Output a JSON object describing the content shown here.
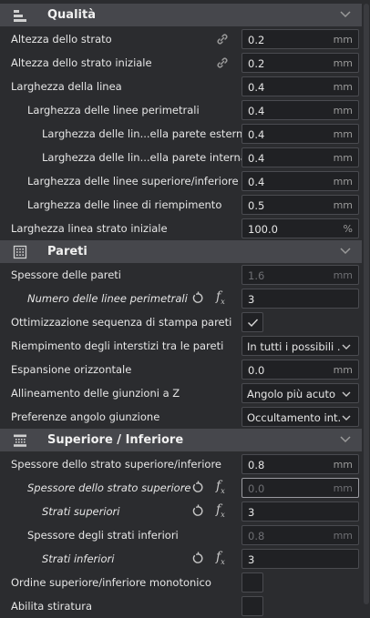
{
  "sections": {
    "quality": {
      "title": "Qualità",
      "icon": "quality-layers-icon"
    },
    "walls": {
      "title": "Pareti",
      "icon": "walls-grid-icon"
    },
    "top_bottom": {
      "title": "Superiore / Inferiore",
      "icon": "top-bottom-icon"
    }
  },
  "quality_rows": [
    {
      "label": "Altezza dello strato",
      "value": "0.2",
      "unit": "mm"
    },
    {
      "label": "Altezza dello strato iniziale",
      "value": "0.2",
      "unit": "mm"
    },
    {
      "label": "Larghezza della linea",
      "value": "0.4",
      "unit": "mm"
    },
    {
      "label": "Larghezza delle linee perimetrali",
      "value": "0.4",
      "unit": "mm"
    },
    {
      "label": "Larghezza delle lin...ella parete esterna",
      "value": "0.4",
      "unit": "mm"
    },
    {
      "label": "Larghezza delle lin...ella parete interna",
      "value": "0.4",
      "unit": "mm"
    },
    {
      "label": "Larghezza delle linee superiore/inferiore",
      "value": "0.4",
      "unit": "mm"
    },
    {
      "label": "Larghezza delle linee di riempimento",
      "value": "0.5",
      "unit": "mm"
    },
    {
      "label": "Larghezza linea strato iniziale",
      "value": "100.0",
      "unit": "%"
    }
  ],
  "walls_rows": [
    {
      "label": "Spessore delle pareti",
      "value": "1.6",
      "unit": "mm"
    },
    {
      "label": "Numero delle linee perimetrali",
      "value": "3",
      "unit": ""
    },
    {
      "label": "Ottimizzazione sequenza di stampa pareti"
    },
    {
      "label": "Riempimento degli interstizi tra le pareti",
      "value": "In tutti i possibili ..."
    },
    {
      "label": "Espansione orizzontale",
      "value": "0.0",
      "unit": "mm"
    },
    {
      "label": "Allineamento delle giunzioni a Z",
      "value": "Angolo più acuto"
    },
    {
      "label": "Preferenze angolo giunzione",
      "value": "Occultamento int..."
    }
  ],
  "top_bottom_rows": [
    {
      "label": "Spessore dello strato superiore/inferiore",
      "value": "0.8",
      "unit": "mm"
    },
    {
      "label": "Spessore dello strato superiore",
      "value": "0.0",
      "unit": "mm"
    },
    {
      "label": "Strati superiori",
      "value": "3",
      "unit": ""
    },
    {
      "label": "Spessore degli strati inferiori",
      "value": "0.8",
      "unit": "mm"
    },
    {
      "label": "Strati inferiori",
      "value": "3",
      "unit": ""
    },
    {
      "label": "Ordine superiore/inferiore monotonico"
    },
    {
      "label": "Abilita stiratura"
    }
  ],
  "checkbox_states": {
    "optimize_wall_order": true,
    "monotonic": false,
    "ironing": false
  }
}
